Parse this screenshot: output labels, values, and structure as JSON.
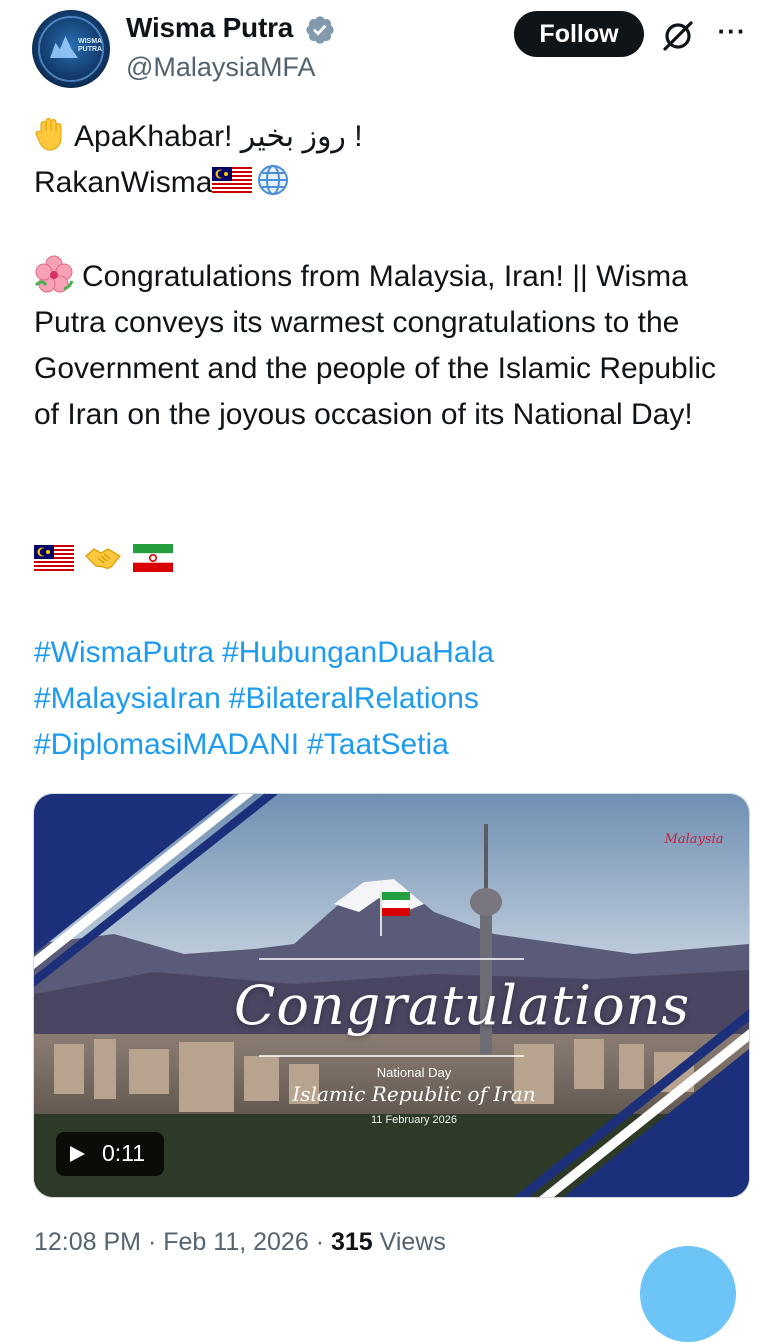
{
  "author": {
    "avatar_text": "WISMA PUTRA",
    "name": "Wisma Putra",
    "handle": "@MalaysiaMFA",
    "verified_icon": "verified-badge-icon"
  },
  "actions": {
    "follow_label": "Follow",
    "grok_icon": "grok-icon",
    "more_label": "···"
  },
  "tweet": {
    "greeting_main": "ApaKhabar! روز بخیر !",
    "greeting_tag": "RakanWisma",
    "congrats_text": "Congratulations from Malaysia, Iran! || Wisma Putra conveys its warmest congratulations to the Government and the people of the Islamic Republic of Iran on the joyous occasion of its National Day!",
    "hashtags": [
      "#WismaPutra",
      "#HubunganDuaHala",
      "#MalaysiaIran",
      "#BilateralRelations",
      "#DiplomasiMADANI",
      "#TaatSetia"
    ]
  },
  "media": {
    "logo_text": "Malaysia",
    "overlay_title": "Congratulations",
    "overlay_subtitle": "National Day",
    "overlay_country": "Islamic Republic of Iran",
    "overlay_date": "11 February 2026",
    "duration": "0:11",
    "colors": {
      "navy": "#1b2f7a",
      "sky": "#c9d6e3",
      "mountain": "#4d4f6e"
    }
  },
  "meta": {
    "time": "12:08 PM",
    "date": "Feb 11, 2026",
    "separator": "·",
    "views_count": "315",
    "views_label": "Views"
  },
  "colors": {
    "link": "#1d9bf0",
    "text": "#0f1419",
    "muted": "#536471",
    "follow_bg": "#0f1419"
  }
}
